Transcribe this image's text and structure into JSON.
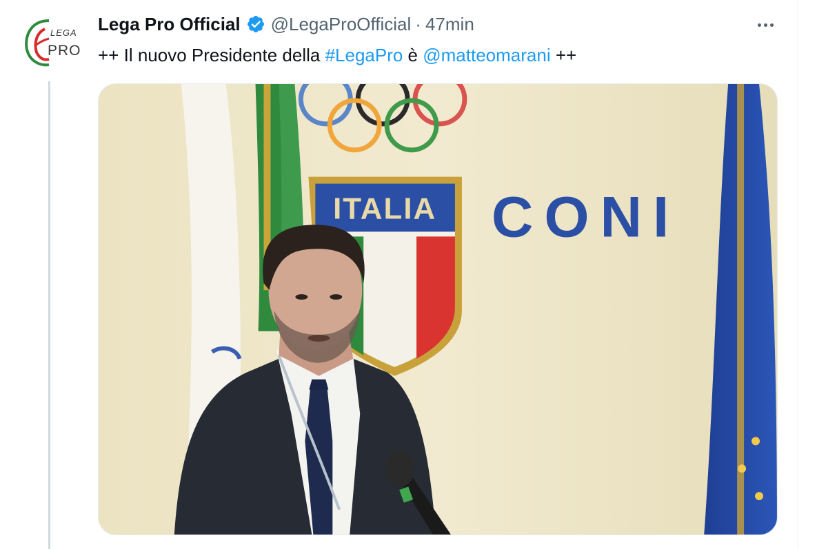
{
  "account": {
    "display_name": "Lega Pro Official",
    "handle": "@LegaProOfficial",
    "separator": "·",
    "time": "47min",
    "verified": true,
    "avatar_logo_text": [
      "LEGA",
      "PRO"
    ]
  },
  "tweet": {
    "text_prefix": "++ Il nuovo Presidente della ",
    "hashtag": "#LegaPro",
    "text_middle": " è ",
    "mention": "@matteomarani",
    "text_suffix": " ++"
  },
  "media": {
    "signage": {
      "shield_label": "ITALIA",
      "wall_label": "CONI"
    }
  },
  "colors": {
    "link": "#1d9bf0",
    "verified_badge": "#1d9bf0",
    "secondary_text": "#536471",
    "thread_line": "#cfd9de"
  },
  "icons": {
    "verified": "verified-badge-icon",
    "more": "more-horizontal-icon"
  }
}
